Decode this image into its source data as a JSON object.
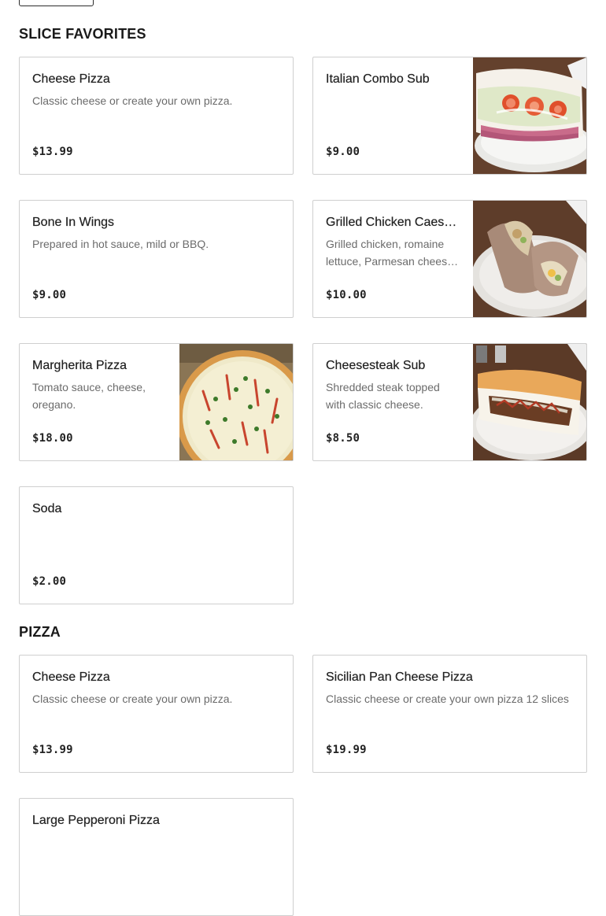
{
  "sections": [
    {
      "title": "SLICE FAVORITES",
      "items": [
        {
          "name": "Cheese Pizza",
          "description": "Classic cheese or create your own pizza.",
          "price": "$13.99",
          "image": null
        },
        {
          "name": "Italian Combo Sub",
          "description": "",
          "price": "$9.00",
          "image": "italian-combo-sub-photo"
        },
        {
          "name": "Bone In Wings",
          "description": "Prepared in hot sauce, mild or BBQ.",
          "price": "$9.00",
          "image": null
        },
        {
          "name": "Grilled Chicken Caesar Wrap",
          "description": "Grilled chicken, romaine lettuce, Parmesan cheese, croutons and Caesar dressing.",
          "price": "$10.00",
          "image": "grilled-chicken-caesar-wrap-photo"
        },
        {
          "name": "Margherita Pizza",
          "description": "Tomato sauce, cheese, oregano.",
          "price": "$18.00",
          "image": "margherita-pizza-photo"
        },
        {
          "name": "Cheesesteak Sub",
          "description": "Shredded steak topped with classic cheese.",
          "price": "$8.50",
          "image": "cheesesteak-sub-photo"
        },
        {
          "name": "Soda",
          "description": "",
          "price": "$2.00",
          "image": null
        }
      ]
    },
    {
      "title": "PIZZA",
      "items": [
        {
          "name": "Cheese Pizza",
          "description": "Classic cheese or create your own pizza.",
          "price": "$13.99",
          "image": null
        },
        {
          "name": "Sicilian Pan Cheese Pizza",
          "description": "Classic cheese or create your own pizza 12 slices",
          "price": "$19.99",
          "image": null
        },
        {
          "name": "Large Pepperoni Pizza",
          "description": "",
          "price": "",
          "image": null
        }
      ]
    }
  ]
}
